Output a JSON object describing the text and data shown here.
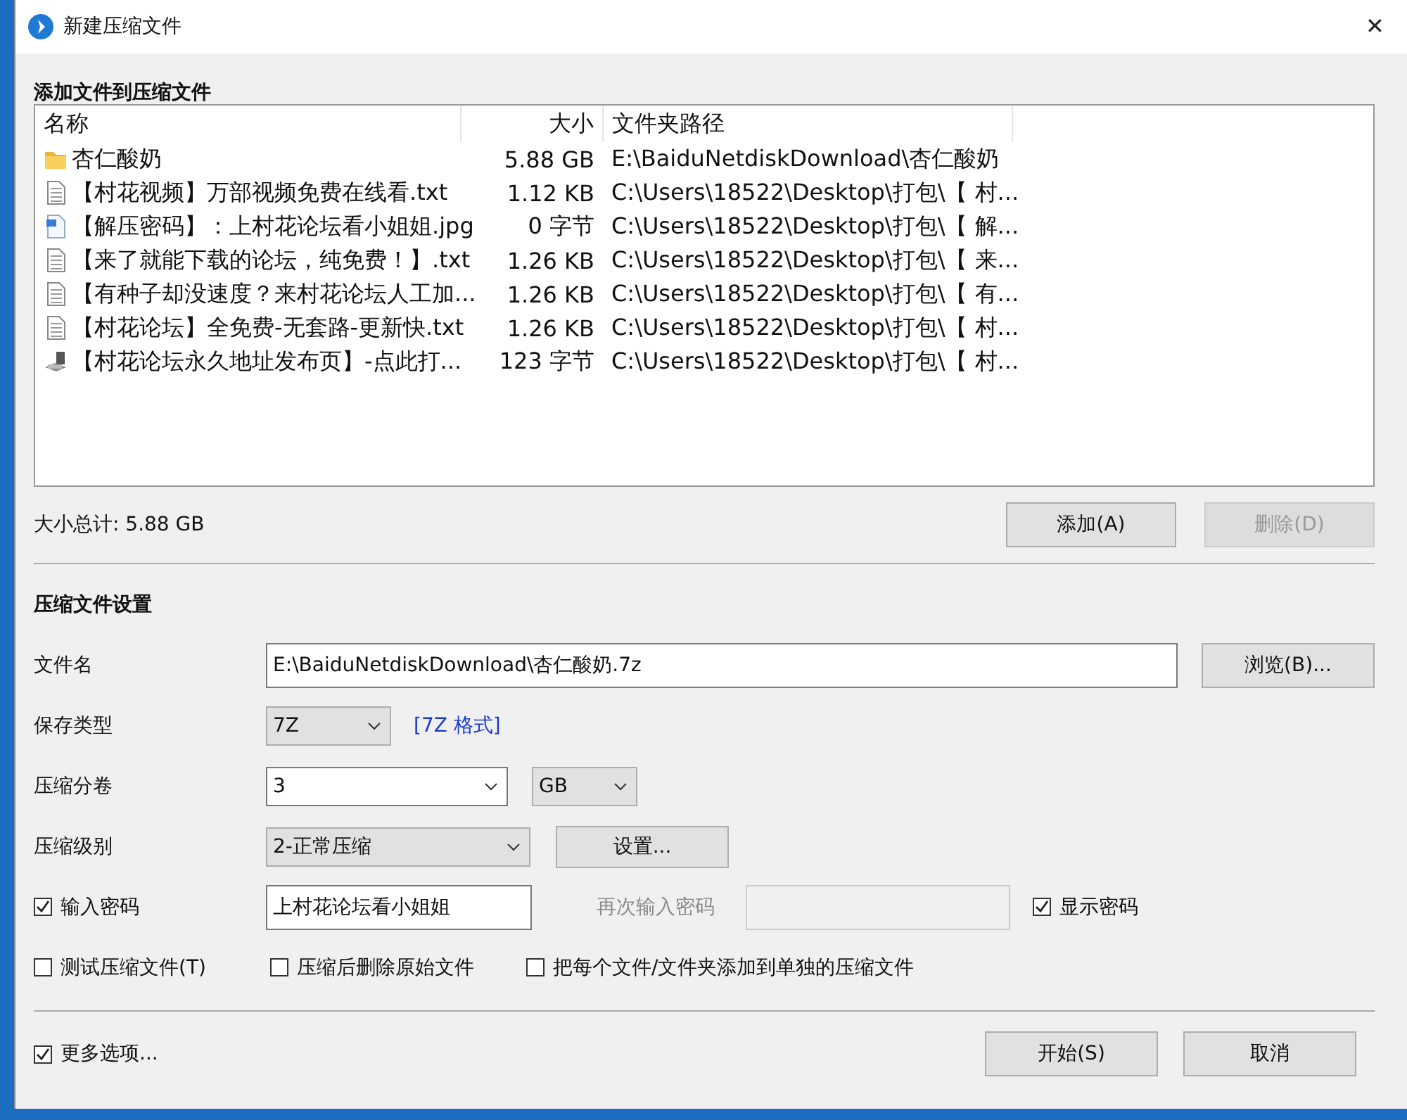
{
  "window": {
    "title": "新建压缩文件",
    "close": "✕"
  },
  "files_section": {
    "title": "添加文件到压缩文件"
  },
  "file_list": {
    "columns": [
      "名称",
      "大小",
      "文件夹路径"
    ],
    "rows": [
      {
        "kind": "folder",
        "name": "杏仁酸奶",
        "size": "5.88 GB",
        "path": "E:\\BaiduNetdiskDownload\\杏仁酸奶"
      },
      {
        "kind": "text",
        "name": "【村花视频】万部视频免费在线看.txt",
        "size": "1.12 KB",
        "path": "C:\\Users\\18522\\Desktop\\打包\\【 村..."
      },
      {
        "kind": "image",
        "name": "【解压密码】：上村花论坛看小姐姐.jpg",
        "size": "0 字节",
        "path": "C:\\Users\\18522\\Desktop\\打包\\【 解..."
      },
      {
        "kind": "text",
        "name": "【来了就能下载的论坛，纯免费！】.txt",
        "size": "1.26 KB",
        "path": "C:\\Users\\18522\\Desktop\\打包\\【 来..."
      },
      {
        "kind": "text",
        "name": "【有种子却没速度？来村花论坛人工加...",
        "size": "1.26 KB",
        "path": "C:\\Users\\18522\\Desktop\\打包\\【 有..."
      },
      {
        "kind": "text",
        "name": "【村花论坛】全免费-无套路-更新快.txt",
        "size": "1.26 KB",
        "path": "C:\\Users\\18522\\Desktop\\打包\\【 村..."
      },
      {
        "kind": "shortcut",
        "name": "【村花论坛永久地址发布页】-点此打...",
        "size": "123 字节",
        "path": "C:\\Users\\18522\\Desktop\\打包\\【 村..."
      }
    ]
  },
  "total": "大小总计: 5.88 GB",
  "list_buttons": [
    {
      "label": "添加(A)",
      "disabled": false
    },
    {
      "label": "删除(D)",
      "disabled": true
    }
  ],
  "settings_section": {
    "title": "压缩文件设置"
  },
  "filename": {
    "label": "文件名",
    "value": "E:\\BaiduNetdiskDownload\\杏仁酸奶.7z",
    "browse": "浏览(B)..."
  },
  "format": {
    "label": "保存类型",
    "value": "7Z",
    "link": "[7Z 格式]"
  },
  "volume": {
    "label": "压缩分卷",
    "value": "3",
    "unit": "GB"
  },
  "level": {
    "label": "压缩级别",
    "value": "2-正常压缩",
    "settings": "设置..."
  },
  "password": {
    "label": "输入密码",
    "checked": true,
    "value": "上村花论坛看小姐姐",
    "confirm_label": "再次输入密码",
    "confirm_disabled": true,
    "show_label": "显示密码",
    "show_checked": true
  },
  "options": [
    {
      "label": "测试压缩文件(T)",
      "checked": false
    },
    {
      "label": "压缩后删除原始文件",
      "checked": false
    },
    {
      "label": "把每个文件/文件夹添加到单独的压缩文件",
      "checked": false
    }
  ],
  "more_options": {
    "label": "更多选项...",
    "checked": true
  },
  "buttons": [
    {
      "label": "开始(S)"
    },
    {
      "label": "取消"
    }
  ]
}
